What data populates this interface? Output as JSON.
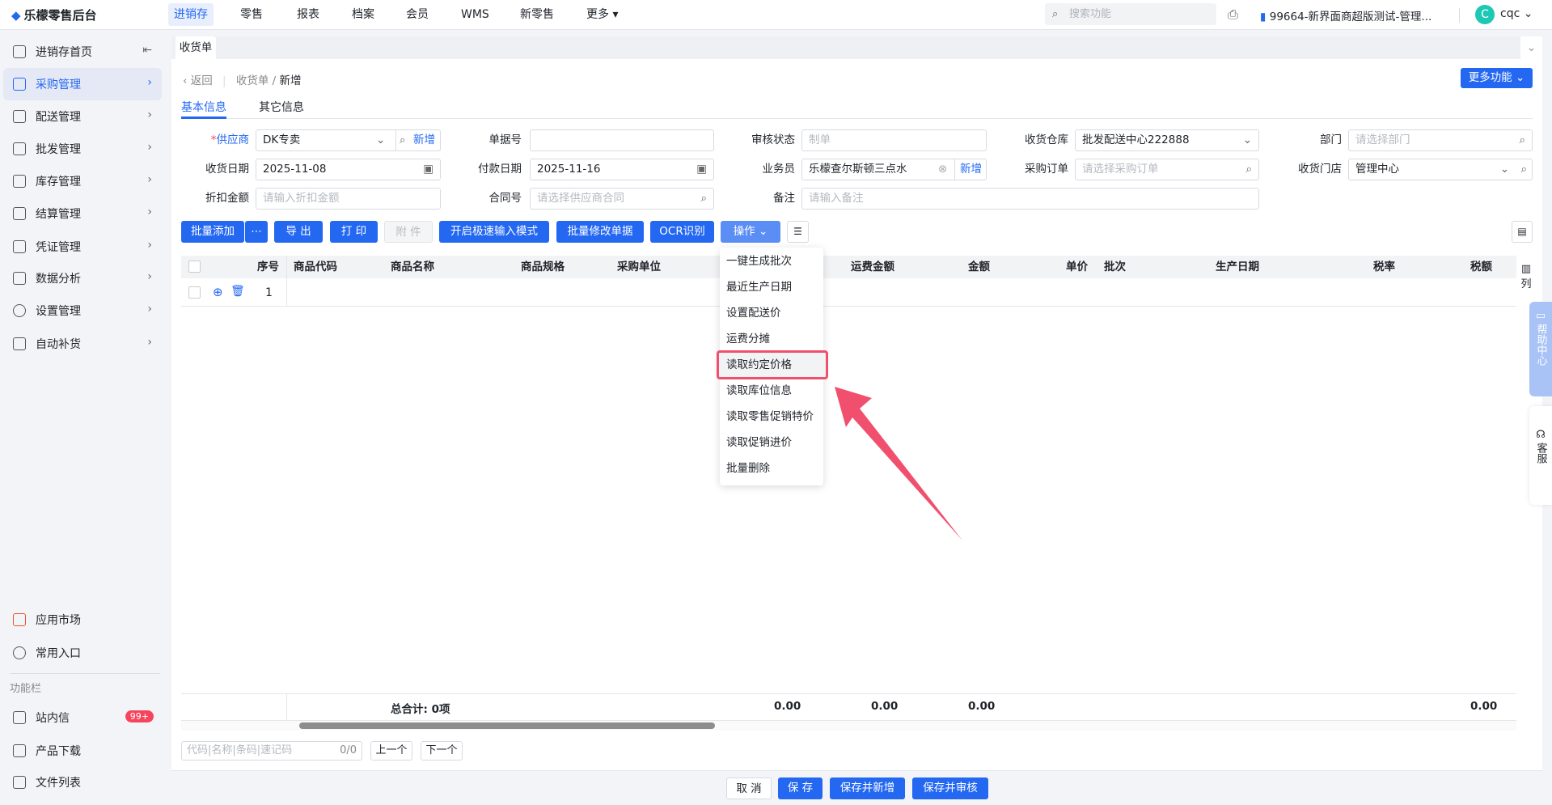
{
  "app": {
    "title": "乐檬零售后台",
    "accent": "#2468f2"
  },
  "topnav": [
    "进销存",
    "零售",
    "报表",
    "档案",
    "会员",
    "WMS",
    "新零售",
    "更多"
  ],
  "search": {
    "placeholder": "搜索功能"
  },
  "store": "99664-新界面商超版测试-管理...",
  "user": {
    "avatar": "C",
    "name": "cqc"
  },
  "sidebar": {
    "items": [
      "进销存首页",
      "采购管理",
      "配送管理",
      "批发管理",
      "库存管理",
      "结算管理",
      "凭证管理",
      "数据分析",
      "设置管理",
      "自动补货"
    ],
    "bottom": [
      "应用市场",
      "常用入口"
    ],
    "section": "功能栏",
    "tools": [
      "站内信",
      "产品下载",
      "文件列表"
    ],
    "badge": "99+"
  },
  "tab": "收货单",
  "breadcrumb": {
    "back": "返回",
    "parent": "收货单",
    "current": "新增"
  },
  "more_button": "更多功能",
  "form_tabs": [
    "基本信息",
    "其它信息"
  ],
  "form": {
    "supplier": {
      "label": "供应商",
      "value": "DK专卖",
      "add": "新增"
    },
    "doc_no": {
      "label": "单据号",
      "value": ""
    },
    "audit": {
      "label": "审核状态",
      "placeholder": "制单"
    },
    "warehouse": {
      "label": "收货仓库",
      "value": "批发配送中心222888"
    },
    "dept": {
      "label": "部门",
      "placeholder": "请选择部门"
    },
    "recv_date": {
      "label": "收货日期",
      "value": "2025-11-08"
    },
    "pay_date": {
      "label": "付款日期",
      "value": "2025-11-16"
    },
    "clerk": {
      "label": "业务员",
      "value": "乐檬查尔斯顿三点水",
      "add": "新增"
    },
    "po": {
      "label": "采购订单",
      "placeholder": "请选择采购订单"
    },
    "store": {
      "label": "收货门店",
      "value": "管理中心"
    },
    "discount": {
      "label": "折扣金额",
      "placeholder": "请输入折扣金额"
    },
    "contract": {
      "label": "合同号",
      "placeholder": "请选择供应商合同"
    },
    "remark": {
      "label": "备注",
      "placeholder": "请输入备注"
    }
  },
  "toolbar": [
    "批量添加",
    "导 出",
    "打 印",
    "附 件",
    "开启极速输入模式",
    "批量修改单据",
    "OCR识别",
    "操作"
  ],
  "table": {
    "headers": [
      "序号",
      "商品代码",
      "商品名称",
      "商品规格",
      "采购单位",
      "运费金额",
      "金额",
      "单价",
      "批次",
      "生产日期",
      "税率",
      "税额"
    ],
    "col_setting": "列",
    "rows": [
      {
        "index": "1"
      }
    ],
    "total_label": "总合计: 0项",
    "totals": [
      "0.00",
      "0.00",
      "0.00",
      "0.00"
    ]
  },
  "finder": {
    "placeholder": "代码|名称|条码|速记码",
    "count": "0/0",
    "prev": "上一个",
    "next": "下一个"
  },
  "menu": {
    "items": [
      "一键生成批次",
      "最近生产日期",
      "设置配送价",
      "运费分摊",
      "读取约定价格",
      "读取库位信息",
      "读取零售促销特价",
      "读取促销进价",
      "批量删除"
    ],
    "highlighted": "读取约定价格"
  },
  "footer": [
    "取 消",
    "保 存",
    "保存并新增",
    "保存并审核"
  ],
  "float": {
    "help": "帮助中心",
    "service": "客服"
  }
}
